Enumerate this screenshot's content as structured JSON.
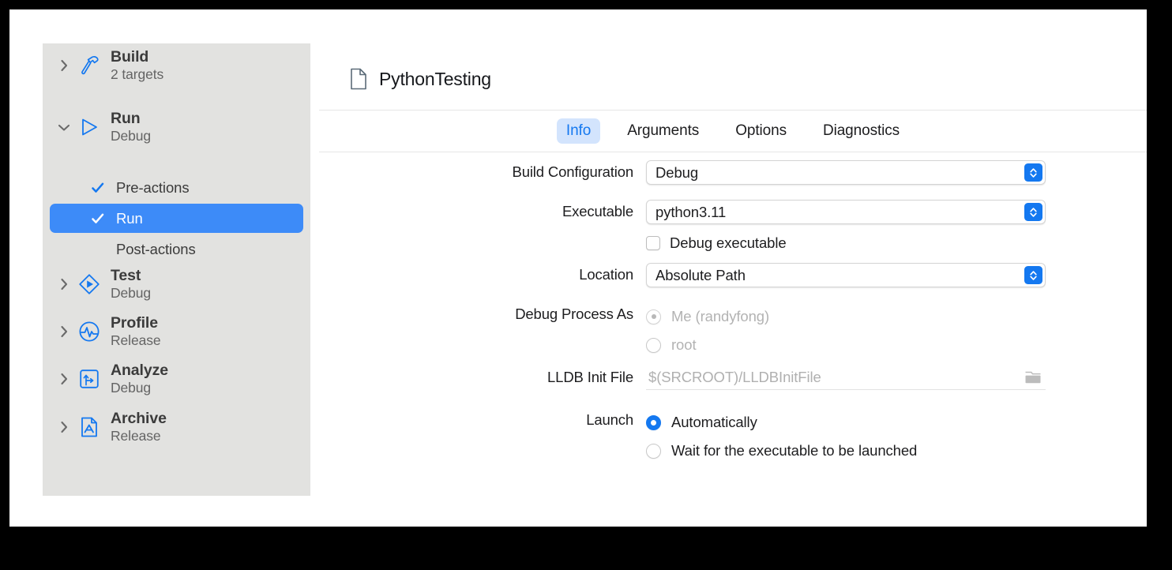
{
  "window": {
    "document_title": "PythonTesting",
    "document_icon": "document-icon"
  },
  "sidebar": {
    "groups": [
      {
        "title": "Build",
        "subtitle": "2 targets",
        "icon": "hammer-icon",
        "disclosure": "chevron-right-icon",
        "expanded": false
      },
      {
        "title": "Run",
        "subtitle": "Debug",
        "icon": "play-triangle-icon",
        "disclosure": "chevron-down-icon",
        "expanded": true
      },
      {
        "title": "Test",
        "subtitle": "Debug",
        "icon": "diamond-play-icon",
        "disclosure": "chevron-right-icon",
        "expanded": false
      },
      {
        "title": "Profile",
        "subtitle": "Release",
        "icon": "waveform-circle-icon",
        "disclosure": "chevron-right-icon",
        "expanded": false
      },
      {
        "title": "Analyze",
        "subtitle": "Debug",
        "icon": "branch-arrow-icon",
        "disclosure": "chevron-right-icon",
        "expanded": false
      },
      {
        "title": "Archive",
        "subtitle": "Release",
        "icon": "archive-app-icon",
        "disclosure": "chevron-right-icon",
        "expanded": false
      }
    ],
    "run_children": [
      {
        "label": "Pre-actions",
        "checked": true,
        "selected": false
      },
      {
        "label": "Run",
        "checked": true,
        "selected": true
      },
      {
        "label": "Post-actions",
        "checked": false,
        "selected": false
      }
    ],
    "selection_color": "#3d8bf8",
    "background_color": "#e2e2e0"
  },
  "tabs": [
    {
      "label": "Info",
      "active": true
    },
    {
      "label": "Arguments",
      "active": false
    },
    {
      "label": "Options",
      "active": false
    },
    {
      "label": "Diagnostics",
      "active": false
    }
  ],
  "form": {
    "build_configuration": {
      "label": "Build Configuration",
      "value": "Debug"
    },
    "executable": {
      "label": "Executable",
      "value": "python3.11"
    },
    "debug_executable": {
      "label": "Debug executable",
      "checked": false
    },
    "location": {
      "label": "Location",
      "value": "Absolute Path"
    },
    "debug_process_as": {
      "label": "Debug Process As",
      "options": [
        {
          "label": "Me (randyfong)",
          "selected": true,
          "disabled": true
        },
        {
          "label": "root",
          "selected": false,
          "disabled": true
        }
      ]
    },
    "lldb_init_file": {
      "label": "LLDB Init File",
      "placeholder": "$(SRCROOT)/LLDBInitFile",
      "value": "",
      "browse_icon": "folder-icon"
    },
    "launch": {
      "label": "Launch",
      "options": [
        {
          "label": "Automatically",
          "selected": true
        },
        {
          "label": "Wait for the executable to be launched",
          "selected": false
        }
      ]
    }
  },
  "colors": {
    "accent_blue": "#1478f0",
    "selection_blue": "#3d8bf8",
    "tab_pill": "#d3e4fd",
    "sidebar_bg": "#e2e2e0"
  }
}
